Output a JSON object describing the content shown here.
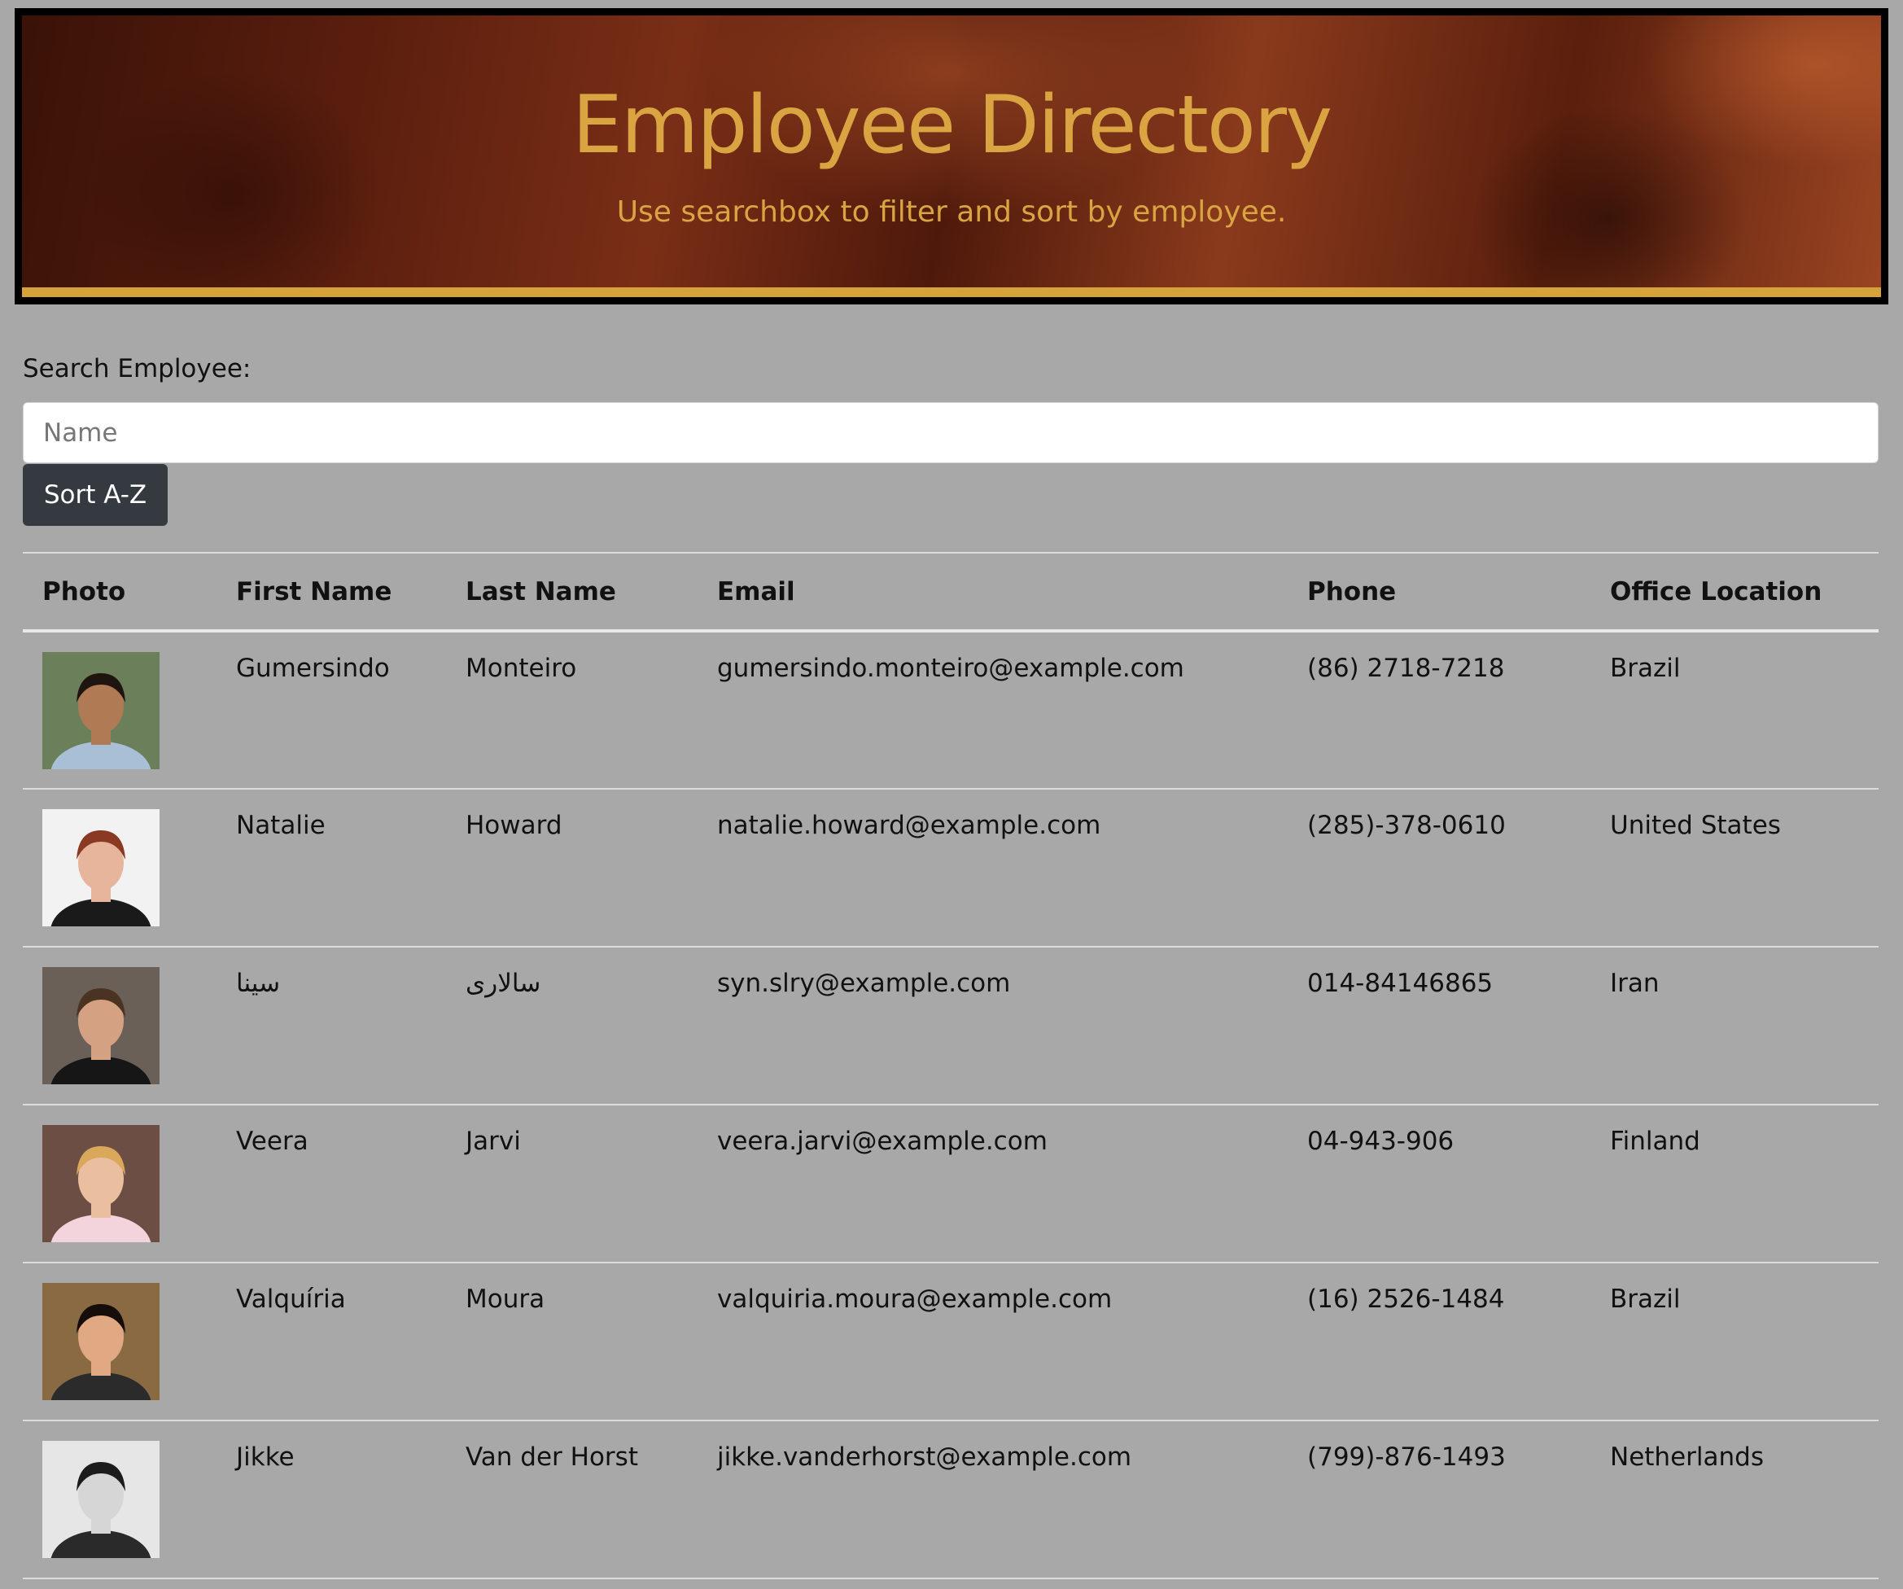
{
  "header": {
    "title": "Employee Directory",
    "subtitle": "Use searchbox to filter and sort by employee."
  },
  "search": {
    "label": "Search Employee:",
    "placeholder": "Name",
    "value": ""
  },
  "sort_button": {
    "label": "Sort A-Z"
  },
  "table": {
    "columns": [
      "Photo",
      "First Name",
      "Last Name",
      "Email",
      "Phone",
      "Office Location"
    ],
    "rows": [
      {
        "first": "Gumersindo",
        "last": "Monteiro",
        "email": "gumersindo.monteiro@example.com",
        "phone": "(86) 2718-7218",
        "location": "Brazil",
        "photo": {
          "bg": "#6b7f5a",
          "skin": "#b07a55",
          "hair": "#1e1510",
          "shirt": "#a9bfd6"
        }
      },
      {
        "first": "Natalie",
        "last": "Howard",
        "email": "natalie.howard@example.com",
        "phone": "(285)-378-0610",
        "location": "United States",
        "photo": {
          "bg": "#f2f2f2",
          "skin": "#e7b59c",
          "hair": "#8a3a22",
          "shirt": "#1a1a1a"
        }
      },
      {
        "first": "سينا",
        "last": "سالاری",
        "email": "syn.slry@example.com",
        "phone": "014-84146865",
        "location": "Iran",
        "photo": {
          "bg": "#6a6058",
          "skin": "#d4a283",
          "hair": "#4a3322",
          "shirt": "#161616"
        }
      },
      {
        "first": "Veera",
        "last": "Jarvi",
        "email": "veera.jarvi@example.com",
        "phone": "04-943-906",
        "location": "Finland",
        "photo": {
          "bg": "#6d4e44",
          "skin": "#e9bf9f",
          "hair": "#d9a85a",
          "shirt": "#f3d3dc"
        }
      },
      {
        "first": "Valquíria",
        "last": "Moura",
        "email": "valquiria.moura@example.com",
        "phone": "(16) 2526-1484",
        "location": "Brazil",
        "photo": {
          "bg": "#8a6a42",
          "skin": "#e0a983",
          "hair": "#140d09",
          "shirt": "#2b2b2b"
        }
      },
      {
        "first": "Jikke",
        "last": "Van der Horst",
        "email": "jikke.vanderhorst@example.com",
        "phone": "(799)-876-1493",
        "location": "Netherlands",
        "photo": {
          "bg": "#e6e6e6",
          "skin": "#d6d6d6",
          "hair": "#1c1c1c",
          "shirt": "#2a2a2a"
        }
      }
    ]
  },
  "colors": {
    "page_bg": "#a8a8a8",
    "accent_gold": "#d9a441",
    "button_dark": "#343a40"
  }
}
